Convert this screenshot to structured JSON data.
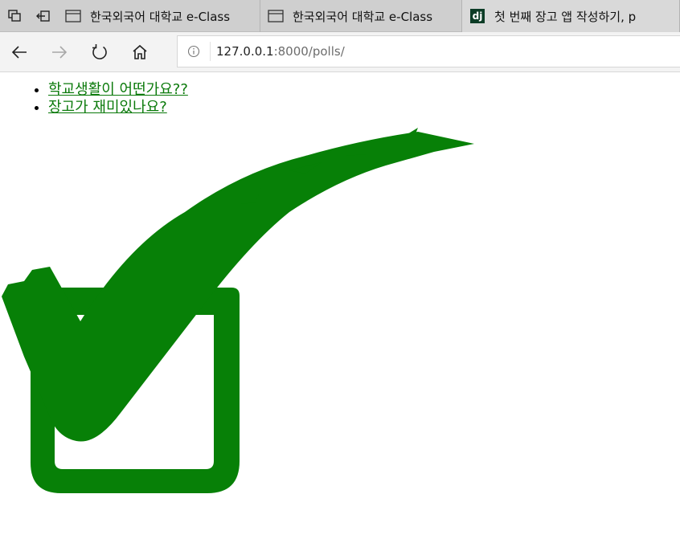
{
  "browser": {
    "tabs": [
      {
        "title": "한국외국어 대학교 e-Class",
        "icon": "page-icon"
      },
      {
        "title": "한국외국어 대학교 e-Class",
        "icon": "page-icon"
      },
      {
        "title": "첫 번째 장고 앱 작성하기, p",
        "icon": "django-icon",
        "icon_text": "dj"
      }
    ],
    "address": {
      "host": "127.0.0.1",
      "rest": ":8000/polls/"
    }
  },
  "polls": [
    {
      "question": "학교생활이 어떤가요??"
    },
    {
      "question": "장고가 재미있나요?"
    }
  ],
  "colors": {
    "link": "#0b7a0b",
    "check": "#078007",
    "tabbar": "#cfcfcf"
  }
}
